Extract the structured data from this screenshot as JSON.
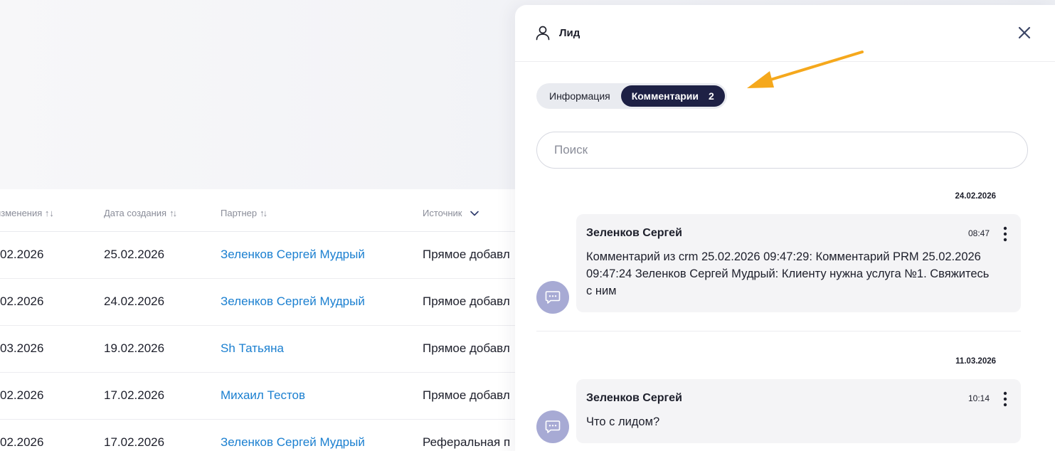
{
  "table": {
    "headers": [
      "изменения ↑↓",
      "Дата создания",
      "Партнер",
      "Источник"
    ],
    "rows": [
      {
        "c1": "02.2026",
        "c2": "25.02.2026",
        "c3": "Зеленков Сергей Мудрый",
        "c4": "Прямое добавл"
      },
      {
        "c1": "02.2026",
        "c2": "24.02.2026",
        "c3": "Зеленков Сергей Мудрый",
        "c4": "Прямое добавл"
      },
      {
        "c1": "03.2026",
        "c2": "19.02.2026",
        "c3": "Sh Татьяна",
        "c4": "Прямое добавл"
      },
      {
        "c1": "02.2026",
        "c2": "17.02.2026",
        "c3": "Михаил Тестов",
        "c4": "Прямое добавл"
      },
      {
        "c1": "02.2026",
        "c2": "17.02.2026",
        "c3": "Зеленков Сергей Мудрый",
        "c4": "Реферальная п"
      }
    ]
  },
  "drawer": {
    "title": "Лид",
    "tabs": [
      {
        "label": "Информация",
        "active": false
      },
      {
        "label": "Комментарии",
        "count": "2",
        "active": true
      }
    ],
    "search_placeholder": "Поиск",
    "comments": [
      {
        "date": "24.02.2026",
        "author": "Зеленков Сергей",
        "time": "08:47",
        "text": "Комментарий из crm 25.02.2026 09:47:29: Комментарий PRM 25.02.2026 09:47:24 Зеленков Сергей Мудрый: Клиенту нужна услуга №1. Свяжитесь с ним"
      },
      {
        "date": "11.03.2026",
        "author": "Зеленков Сергей",
        "time": "10:14",
        "text": "Что с лидом?"
      }
    ]
  },
  "colors": {
    "accent_dark": "#1e2145",
    "link": "#1a7fd0",
    "annotation_arrow": "#f5a81c",
    "avatar": "#a7aad4"
  },
  "icons": [
    "user-icon",
    "close-icon",
    "sort-icon",
    "chevron-down-icon",
    "comment-icon",
    "more-vertical-icon",
    "annotation-arrow"
  ]
}
